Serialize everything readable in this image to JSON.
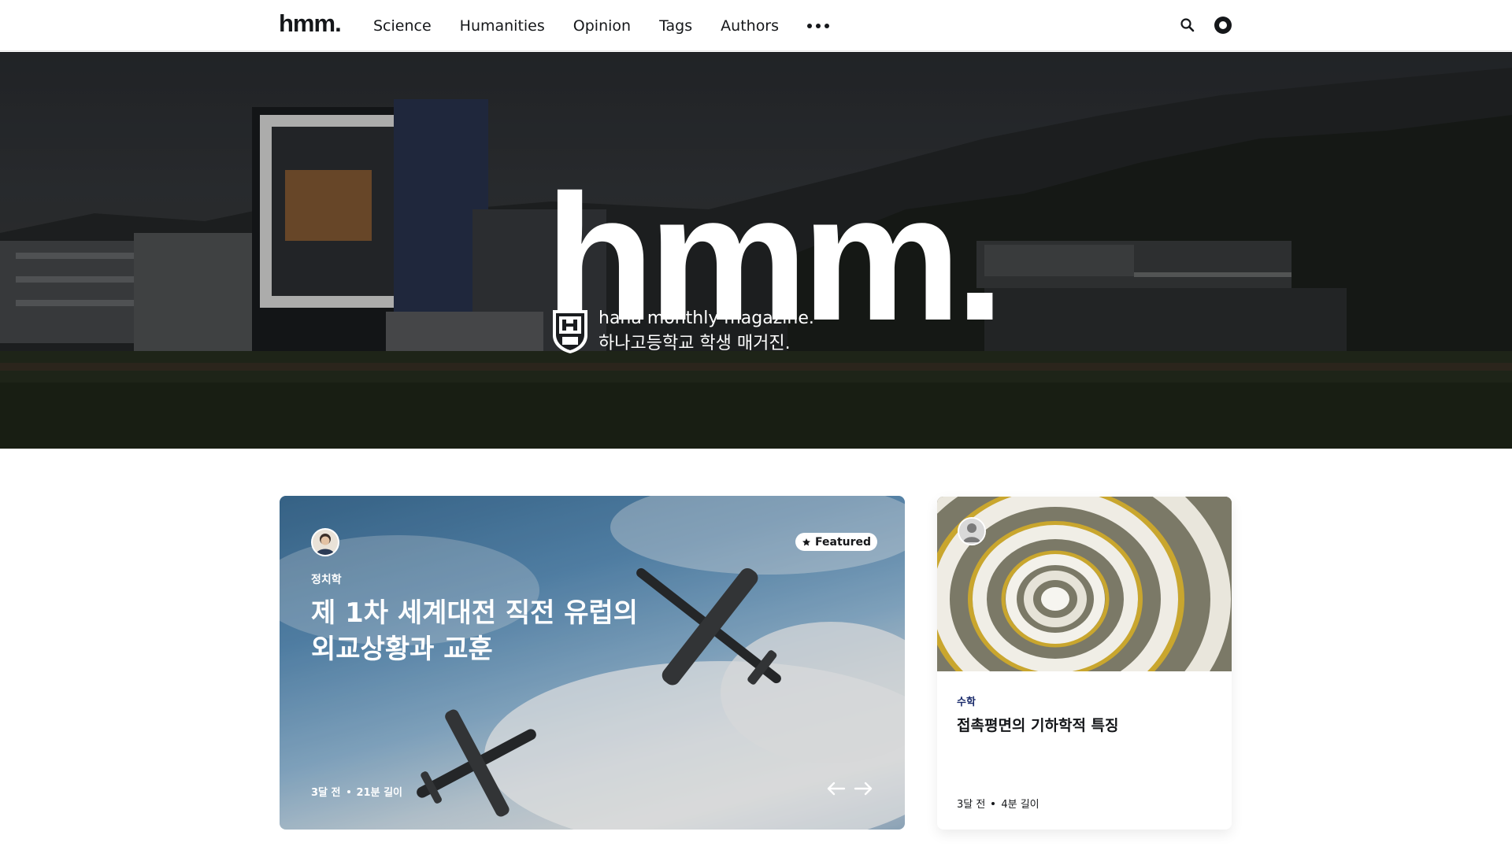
{
  "header": {
    "logo": "hmm.",
    "nav": [
      {
        "label": "Science"
      },
      {
        "label": "Humanities"
      },
      {
        "label": "Opinion"
      },
      {
        "label": "Tags"
      },
      {
        "label": "Authors"
      }
    ],
    "more_icon": "more-dots-icon",
    "search_icon": "search-icon",
    "theme_icon": "theme-toggle-icon"
  },
  "hero": {
    "title": "hmm.",
    "subtitle_line1": "hana monthly magazine.",
    "subtitle_line2": "하나고등학교 학생 매거진.",
    "badge_icon": "school-crest-icon"
  },
  "featured": {
    "badge": "Featured",
    "badge_icon": "star-icon",
    "tag": "정치학",
    "title_line1": "제 1차 세계대전 직전 유럽의",
    "title_line2": "외교상황과 교훈",
    "date": "3달 전",
    "read_time": "21분 길이",
    "prev_icon": "arrow-left-icon",
    "next_icon": "arrow-right-icon"
  },
  "side_post": {
    "tag": "수학",
    "title": "접촉평면의 기하학적 특징",
    "date": "3달 전",
    "read_time": "4분 길이",
    "avatar_icon": "user-avatar-icon"
  }
}
